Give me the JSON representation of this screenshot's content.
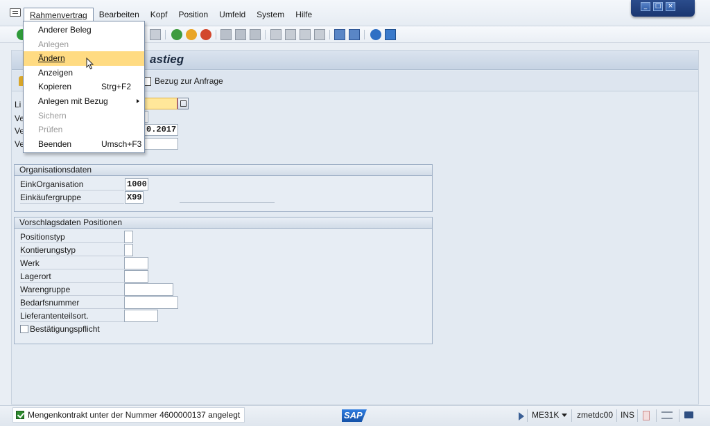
{
  "menubar": {
    "items": [
      {
        "label": "Rahmenvertrag"
      },
      {
        "label": "Bearbeiten"
      },
      {
        "label": "Kopf"
      },
      {
        "label": "Position"
      },
      {
        "label": "Umfeld"
      },
      {
        "label": "System"
      },
      {
        "label": "Hilfe"
      }
    ]
  },
  "dropdown": {
    "items": [
      {
        "label": "Anderer Beleg",
        "shortcut": "",
        "enabled": true
      },
      {
        "label": "Anlegen",
        "shortcut": "",
        "enabled": false
      },
      {
        "label": "Ändern",
        "shortcut": "",
        "enabled": true,
        "highlighted": true
      },
      {
        "label": "Anzeigen",
        "shortcut": "",
        "enabled": true
      },
      {
        "label": "Kopieren",
        "shortcut": "Strg+F2",
        "enabled": true
      },
      {
        "label": "Anlegen mit Bezug",
        "shortcut": "",
        "enabled": true,
        "submenu": true
      },
      {
        "label": "Sichern",
        "shortcut": "",
        "enabled": false
      },
      {
        "label": "Prüfen",
        "shortcut": "",
        "enabled": false
      },
      {
        "label": "Beenden",
        "shortcut": "Umsch+F3",
        "enabled": true
      }
    ]
  },
  "screen": {
    "title_visible": "astieg",
    "ref_button": "Bezug zur Anfrage",
    "header_labels": [
      "Li",
      "Ve",
      "Ve",
      "Ve"
    ],
    "date_field_visible": "0.2017"
  },
  "org": {
    "title": "Organisationsdaten",
    "rows": [
      {
        "label": "EinkOrganisation",
        "value": "1000"
      },
      {
        "label": "Einkäufergruppe",
        "value": "X99"
      }
    ]
  },
  "vorschlag": {
    "title": "Vorschlagsdaten Positionen",
    "rows": [
      {
        "label": "Positionstyp",
        "value": ""
      },
      {
        "label": "Kontierungstyp",
        "value": ""
      },
      {
        "label": "Werk",
        "value": ""
      },
      {
        "label": "Lagerort",
        "value": ""
      },
      {
        "label": "Warengruppe",
        "value": ""
      },
      {
        "label": "Bedarfsnummer",
        "value": ""
      },
      {
        "label": "Lieferantenteilsort.",
        "value": ""
      }
    ],
    "checkbox_label": "Bestätigungspflicht"
  },
  "status": {
    "message": "Mengenkontrakt unter der Nummer 4600000137 angelegt",
    "logo": "SAP",
    "transaction": "ME31K",
    "server": "zmetdc00",
    "mode": "INS"
  },
  "colors": {
    "highlight": "#ffdb82",
    "required_field": "#ffe79a",
    "success": "#2e8b2e",
    "window_controls": "#1a3670"
  }
}
